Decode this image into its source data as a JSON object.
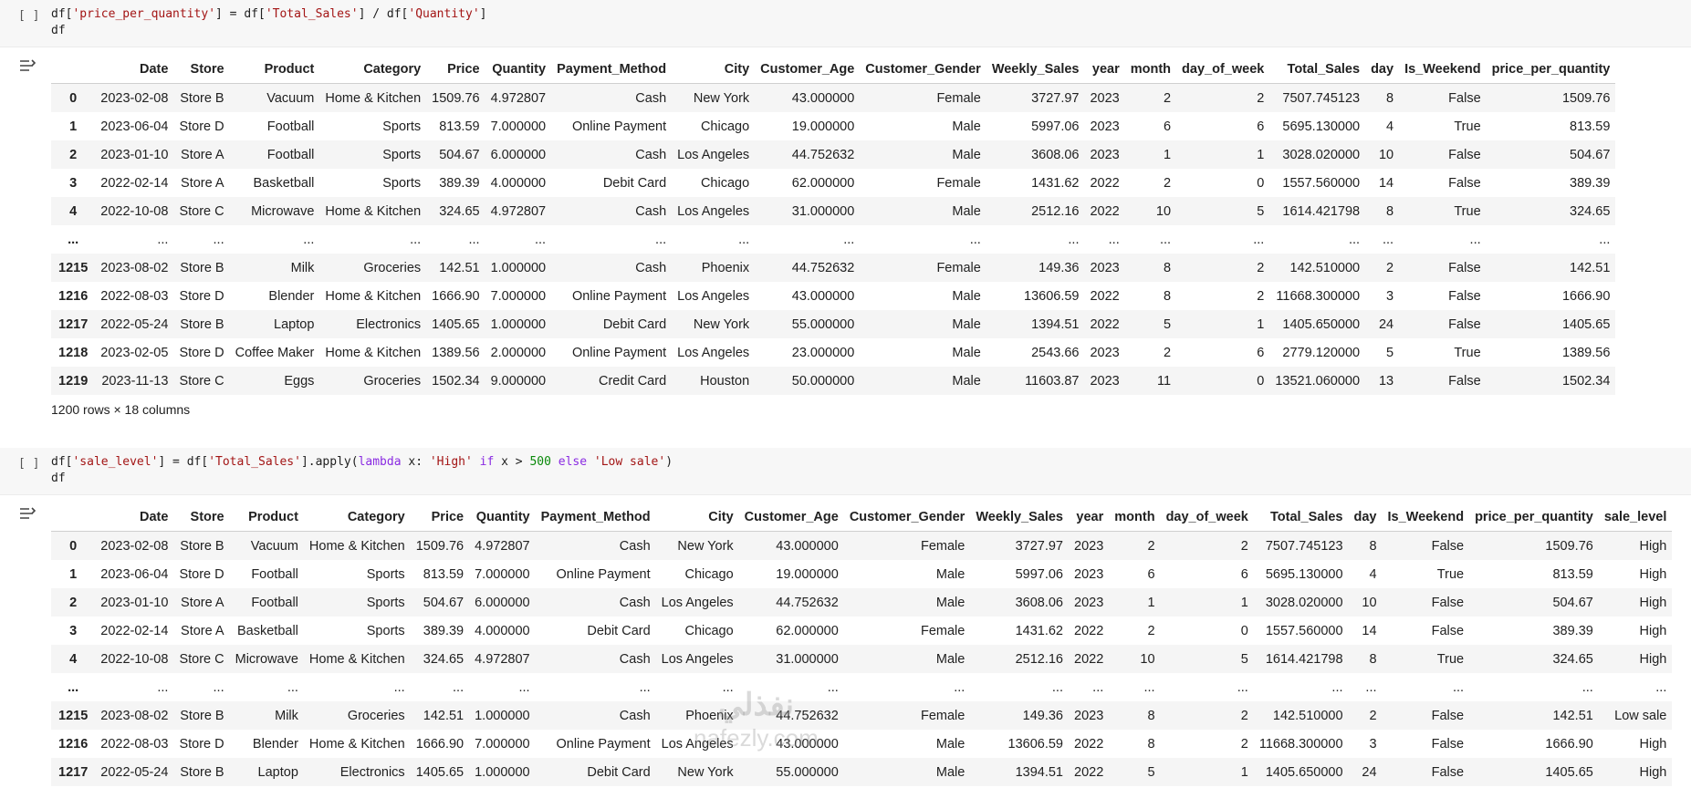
{
  "cell1": {
    "run_label": "[ ]",
    "code_line1_parts": [
      {
        "t": "df[",
        "c": ""
      },
      {
        "t": "'price_per_quantity'",
        "c": "str"
      },
      {
        "t": "] = df[",
        "c": ""
      },
      {
        "t": "'Total_Sales'",
        "c": "str"
      },
      {
        "t": "] / df[",
        "c": ""
      },
      {
        "t": "'Quantity'",
        "c": "str"
      },
      {
        "t": "]",
        "c": ""
      }
    ],
    "code_line2": "df",
    "output_icon": "output-toggle-icon",
    "columns": [
      "",
      "Date",
      "Store",
      "Product",
      "Category",
      "Price",
      "Quantity",
      "Payment_Method",
      "City",
      "Customer_Age",
      "Customer_Gender",
      "Weekly_Sales",
      "year",
      "month",
      "day_of_week",
      "Total_Sales",
      "day",
      "Is_Weekend",
      "price_per_quantity"
    ],
    "rows": [
      [
        "0",
        "2023-02-08",
        "Store B",
        "Vacuum",
        "Home & Kitchen",
        "1509.76",
        "4.972807",
        "Cash",
        "New York",
        "43.000000",
        "Female",
        "3727.97",
        "2023",
        "2",
        "2",
        "7507.745123",
        "8",
        "False",
        "1509.76"
      ],
      [
        "1",
        "2023-06-04",
        "Store D",
        "Football",
        "Sports",
        "813.59",
        "7.000000",
        "Online Payment",
        "Chicago",
        "19.000000",
        "Male",
        "5997.06",
        "2023",
        "6",
        "6",
        "5695.130000",
        "4",
        "True",
        "813.59"
      ],
      [
        "2",
        "2023-01-10",
        "Store A",
        "Football",
        "Sports",
        "504.67",
        "6.000000",
        "Cash",
        "Los Angeles",
        "44.752632",
        "Male",
        "3608.06",
        "2023",
        "1",
        "1",
        "3028.020000",
        "10",
        "False",
        "504.67"
      ],
      [
        "3",
        "2022-02-14",
        "Store A",
        "Basketball",
        "Sports",
        "389.39",
        "4.000000",
        "Debit Card",
        "Chicago",
        "62.000000",
        "Female",
        "1431.62",
        "2022",
        "2",
        "0",
        "1557.560000",
        "14",
        "False",
        "389.39"
      ],
      [
        "4",
        "2022-10-08",
        "Store C",
        "Microwave",
        "Home & Kitchen",
        "324.65",
        "4.972807",
        "Cash",
        "Los Angeles",
        "31.000000",
        "Male",
        "2512.16",
        "2022",
        "10",
        "5",
        "1614.421798",
        "8",
        "True",
        "324.65"
      ],
      [
        "...",
        "...",
        "...",
        "...",
        "...",
        "...",
        "...",
        "...",
        "...",
        "...",
        "...",
        "...",
        "...",
        "...",
        "...",
        "...",
        "...",
        "...",
        "..."
      ],
      [
        "1215",
        "2023-08-02",
        "Store B",
        "Milk",
        "Groceries",
        "142.51",
        "1.000000",
        "Cash",
        "Phoenix",
        "44.752632",
        "Female",
        "149.36",
        "2023",
        "8",
        "2",
        "142.510000",
        "2",
        "False",
        "142.51"
      ],
      [
        "1216",
        "2022-08-03",
        "Store D",
        "Blender",
        "Home & Kitchen",
        "1666.90",
        "7.000000",
        "Online Payment",
        "Los Angeles",
        "43.000000",
        "Male",
        "13606.59",
        "2022",
        "8",
        "2",
        "11668.300000",
        "3",
        "False",
        "1666.90"
      ],
      [
        "1217",
        "2022-05-24",
        "Store B",
        "Laptop",
        "Electronics",
        "1405.65",
        "1.000000",
        "Debit Card",
        "New York",
        "55.000000",
        "Male",
        "1394.51",
        "2022",
        "5",
        "1",
        "1405.650000",
        "24",
        "False",
        "1405.65"
      ],
      [
        "1218",
        "2023-02-05",
        "Store D",
        "Coffee Maker",
        "Home & Kitchen",
        "1389.56",
        "2.000000",
        "Online Payment",
        "Los Angeles",
        "23.000000",
        "Male",
        "2543.66",
        "2023",
        "2",
        "6",
        "2779.120000",
        "5",
        "True",
        "1389.56"
      ],
      [
        "1219",
        "2023-11-13",
        "Store C",
        "Eggs",
        "Groceries",
        "1502.34",
        "9.000000",
        "Credit Card",
        "Houston",
        "50.000000",
        "Male",
        "11603.87",
        "2023",
        "11",
        "0",
        "13521.060000",
        "13",
        "False",
        "1502.34"
      ]
    ],
    "shape_text": "1200 rows × 18 columns"
  },
  "cell2": {
    "run_label": "[ ]",
    "code_line1_parts": [
      {
        "t": "df[",
        "c": ""
      },
      {
        "t": "'sale_level'",
        "c": "str"
      },
      {
        "t": "] = df[",
        "c": ""
      },
      {
        "t": "'Total_Sales'",
        "c": "str"
      },
      {
        "t": "].apply(",
        "c": ""
      },
      {
        "t": "lambda",
        "c": "kw"
      },
      {
        "t": " x: ",
        "c": ""
      },
      {
        "t": "'High'",
        "c": "str"
      },
      {
        "t": " ",
        "c": ""
      },
      {
        "t": "if",
        "c": "kw"
      },
      {
        "t": " x > ",
        "c": ""
      },
      {
        "t": "500",
        "c": "num"
      },
      {
        "t": " ",
        "c": ""
      },
      {
        "t": "else",
        "c": "kw"
      },
      {
        "t": " ",
        "c": ""
      },
      {
        "t": "'Low sale'",
        "c": "str"
      },
      {
        "t": ")",
        "c": ""
      }
    ],
    "code_line2": "df",
    "output_icon": "output-toggle-icon",
    "columns": [
      "",
      "Date",
      "Store",
      "Product",
      "Category",
      "Price",
      "Quantity",
      "Payment_Method",
      "City",
      "Customer_Age",
      "Customer_Gender",
      "Weekly_Sales",
      "year",
      "month",
      "day_of_week",
      "Total_Sales",
      "day",
      "Is_Weekend",
      "price_per_quantity",
      "sale_level"
    ],
    "rows": [
      [
        "0",
        "2023-02-08",
        "Store B",
        "Vacuum",
        "Home & Kitchen",
        "1509.76",
        "4.972807",
        "Cash",
        "New York",
        "43.000000",
        "Female",
        "3727.97",
        "2023",
        "2",
        "2",
        "7507.745123",
        "8",
        "False",
        "1509.76",
        "High"
      ],
      [
        "1",
        "2023-06-04",
        "Store D",
        "Football",
        "Sports",
        "813.59",
        "7.000000",
        "Online Payment",
        "Chicago",
        "19.000000",
        "Male",
        "5997.06",
        "2023",
        "6",
        "6",
        "5695.130000",
        "4",
        "True",
        "813.59",
        "High"
      ],
      [
        "2",
        "2023-01-10",
        "Store A",
        "Football",
        "Sports",
        "504.67",
        "6.000000",
        "Cash",
        "Los Angeles",
        "44.752632",
        "Male",
        "3608.06",
        "2023",
        "1",
        "1",
        "3028.020000",
        "10",
        "False",
        "504.67",
        "High"
      ],
      [
        "3",
        "2022-02-14",
        "Store A",
        "Basketball",
        "Sports",
        "389.39",
        "4.000000",
        "Debit Card",
        "Chicago",
        "62.000000",
        "Female",
        "1431.62",
        "2022",
        "2",
        "0",
        "1557.560000",
        "14",
        "False",
        "389.39",
        "High"
      ],
      [
        "4",
        "2022-10-08",
        "Store C",
        "Microwave",
        "Home & Kitchen",
        "324.65",
        "4.972807",
        "Cash",
        "Los Angeles",
        "31.000000",
        "Male",
        "2512.16",
        "2022",
        "10",
        "5",
        "1614.421798",
        "8",
        "True",
        "324.65",
        "High"
      ],
      [
        "...",
        "...",
        "...",
        "...",
        "...",
        "...",
        "...",
        "...",
        "...",
        "...",
        "...",
        "...",
        "...",
        "...",
        "...",
        "...",
        "...",
        "...",
        "...",
        "..."
      ],
      [
        "1215",
        "2023-08-02",
        "Store B",
        "Milk",
        "Groceries",
        "142.51",
        "1.000000",
        "Cash",
        "Phoenix",
        "44.752632",
        "Female",
        "149.36",
        "2023",
        "8",
        "2",
        "142.510000",
        "2",
        "False",
        "142.51",
        "Low sale"
      ],
      [
        "1216",
        "2022-08-03",
        "Store D",
        "Blender",
        "Home & Kitchen",
        "1666.90",
        "7.000000",
        "Online Payment",
        "Los Angeles",
        "43.000000",
        "Male",
        "13606.59",
        "2022",
        "8",
        "2",
        "11668.300000",
        "3",
        "False",
        "1666.90",
        "High"
      ],
      [
        "1217",
        "2022-05-24",
        "Store B",
        "Laptop",
        "Electronics",
        "1405.65",
        "1.000000",
        "Debit Card",
        "New York",
        "55.000000",
        "Male",
        "1394.51",
        "2022",
        "5",
        "1",
        "1405.650000",
        "24",
        "False",
        "1405.65",
        "High"
      ]
    ]
  },
  "watermark": {
    "line1": "نفذلي",
    "line2": "nafezly.com"
  },
  "colors": {
    "string": "#a31515",
    "keyword": "#8a2be2",
    "number": "#0a8a0a",
    "stripe": "#f5f5f5"
  }
}
